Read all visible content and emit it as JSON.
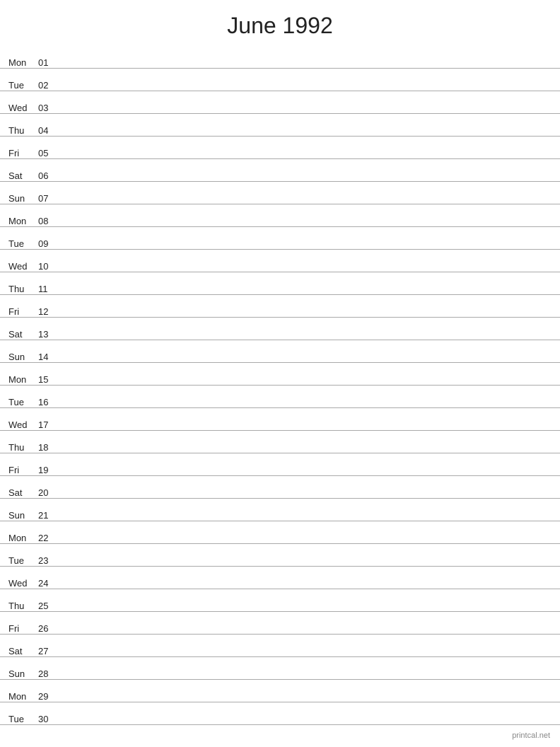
{
  "title": "June 1992",
  "days": [
    {
      "name": "Mon",
      "num": "01"
    },
    {
      "name": "Tue",
      "num": "02"
    },
    {
      "name": "Wed",
      "num": "03"
    },
    {
      "name": "Thu",
      "num": "04"
    },
    {
      "name": "Fri",
      "num": "05"
    },
    {
      "name": "Sat",
      "num": "06"
    },
    {
      "name": "Sun",
      "num": "07"
    },
    {
      "name": "Mon",
      "num": "08"
    },
    {
      "name": "Tue",
      "num": "09"
    },
    {
      "name": "Wed",
      "num": "10"
    },
    {
      "name": "Thu",
      "num": "11"
    },
    {
      "name": "Fri",
      "num": "12"
    },
    {
      "name": "Sat",
      "num": "13"
    },
    {
      "name": "Sun",
      "num": "14"
    },
    {
      "name": "Mon",
      "num": "15"
    },
    {
      "name": "Tue",
      "num": "16"
    },
    {
      "name": "Wed",
      "num": "17"
    },
    {
      "name": "Thu",
      "num": "18"
    },
    {
      "name": "Fri",
      "num": "19"
    },
    {
      "name": "Sat",
      "num": "20"
    },
    {
      "name": "Sun",
      "num": "21"
    },
    {
      "name": "Mon",
      "num": "22"
    },
    {
      "name": "Tue",
      "num": "23"
    },
    {
      "name": "Wed",
      "num": "24"
    },
    {
      "name": "Thu",
      "num": "25"
    },
    {
      "name": "Fri",
      "num": "26"
    },
    {
      "name": "Sat",
      "num": "27"
    },
    {
      "name": "Sun",
      "num": "28"
    },
    {
      "name": "Mon",
      "num": "29"
    },
    {
      "name": "Tue",
      "num": "30"
    }
  ],
  "footer": "printcal.net"
}
